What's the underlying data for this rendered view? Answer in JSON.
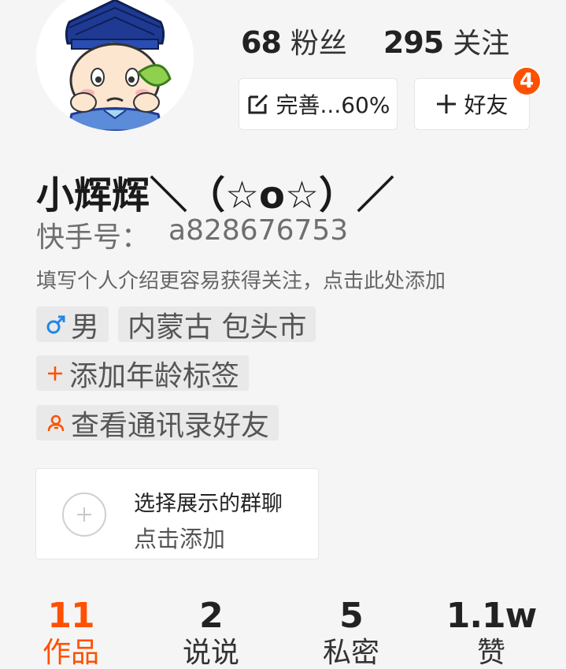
{
  "stats": {
    "fans": {
      "count": "68",
      "label": "粉丝"
    },
    "following": {
      "count": "295",
      "label": "关注"
    }
  },
  "actions": {
    "complete_label": "完善...60%",
    "complete_progress": 60,
    "add_friend_label": "好友",
    "add_friend_badge": "4",
    "accent_color": "#ff5000"
  },
  "profile": {
    "nickname": "小辉辉＼（☆o☆）／",
    "account_label": "快手号：",
    "account_id": "a828676753",
    "bio_placeholder": "填写个人介绍更容易获得关注，点击此处添加"
  },
  "tags": {
    "gender": {
      "icon": "male-icon",
      "label": "男",
      "color": "#1e88e5"
    },
    "location": "内蒙古 包头市",
    "add_age": {
      "icon": "plus-icon",
      "label": "添加年龄标签",
      "color": "#ff5000"
    },
    "contacts": {
      "icon": "contacts-icon",
      "label": "查看通讯录好友",
      "color": "#ff5000"
    }
  },
  "group_chat": {
    "title": "选择展示的群聊",
    "subtitle": "点击添加",
    "icon": "plus-circle-icon"
  },
  "tabs": [
    {
      "count": "11",
      "label": "作品",
      "active": true
    },
    {
      "count": "2",
      "label": "说说",
      "active": false
    },
    {
      "count": "5",
      "label": "私密",
      "active": false
    },
    {
      "count": "1.1w",
      "label": "赞",
      "active": false
    }
  ]
}
